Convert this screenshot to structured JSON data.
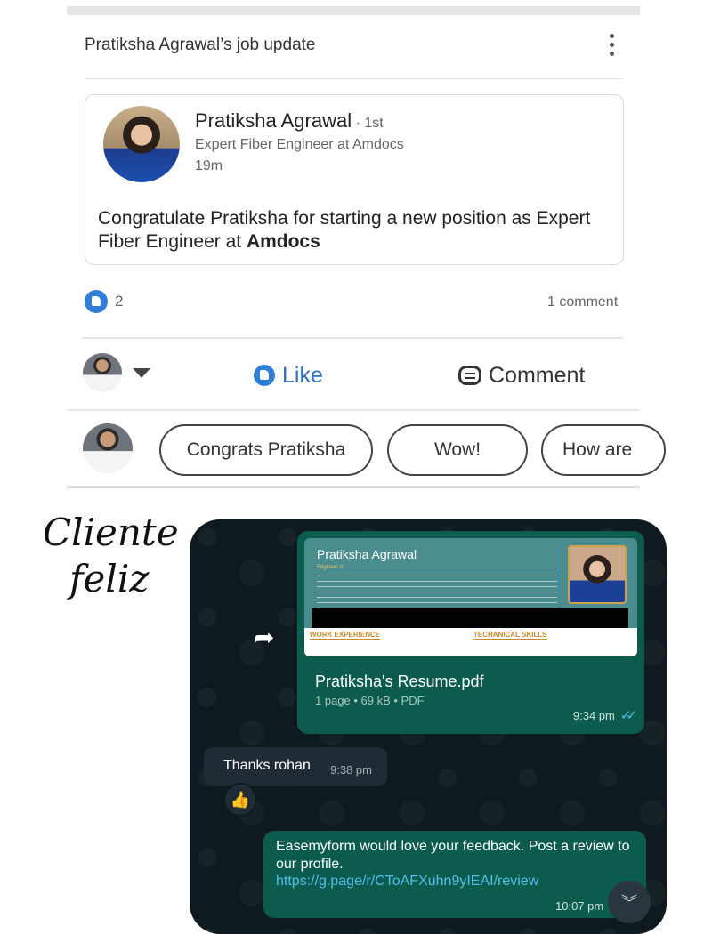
{
  "linkedin": {
    "header": "Pratiksha Agrawal’s job update",
    "post": {
      "name": "Pratiksha Agrawal",
      "degree": " · 1st",
      "title": "Expert Fiber Engineer at Amdocs",
      "time": "19m",
      "message_prefix": "Congratulate Pratiksha for starting a new position as Expert Fiber Engineer at ",
      "message_company": "Amdocs"
    },
    "reactions": {
      "count": "2",
      "comments": "1 comment"
    },
    "actions": {
      "like": "Like",
      "comment": "Comment"
    },
    "quick_replies": [
      "Congrats Pratiksha",
      "Wow!",
      "How are"
    ]
  },
  "handwriting": {
    "line1": "Cliente",
    "line2": "feliz"
  },
  "whatsapp": {
    "doc": {
      "preview_name": "Pratiksha Agrawal",
      "preview_subtitle": "Engineer II",
      "section1": "WORK EXPERIENCE",
      "section2": "TECHANICAL SKILLS",
      "file_name": "Pratiksha's Resume.pdf",
      "file_meta": "1 page • 69 kB • PDF",
      "time": "9:34 pm"
    },
    "incoming": {
      "text": "Thanks rohan",
      "time": "9:38 pm",
      "reaction": "👍"
    },
    "outgoing": {
      "text": "Easemyform would love your feedback. Post a review to our profile.",
      "link": "https://g.page/r/CToAFXuhn9yIEAI/review",
      "time": "10:07 pm"
    }
  }
}
